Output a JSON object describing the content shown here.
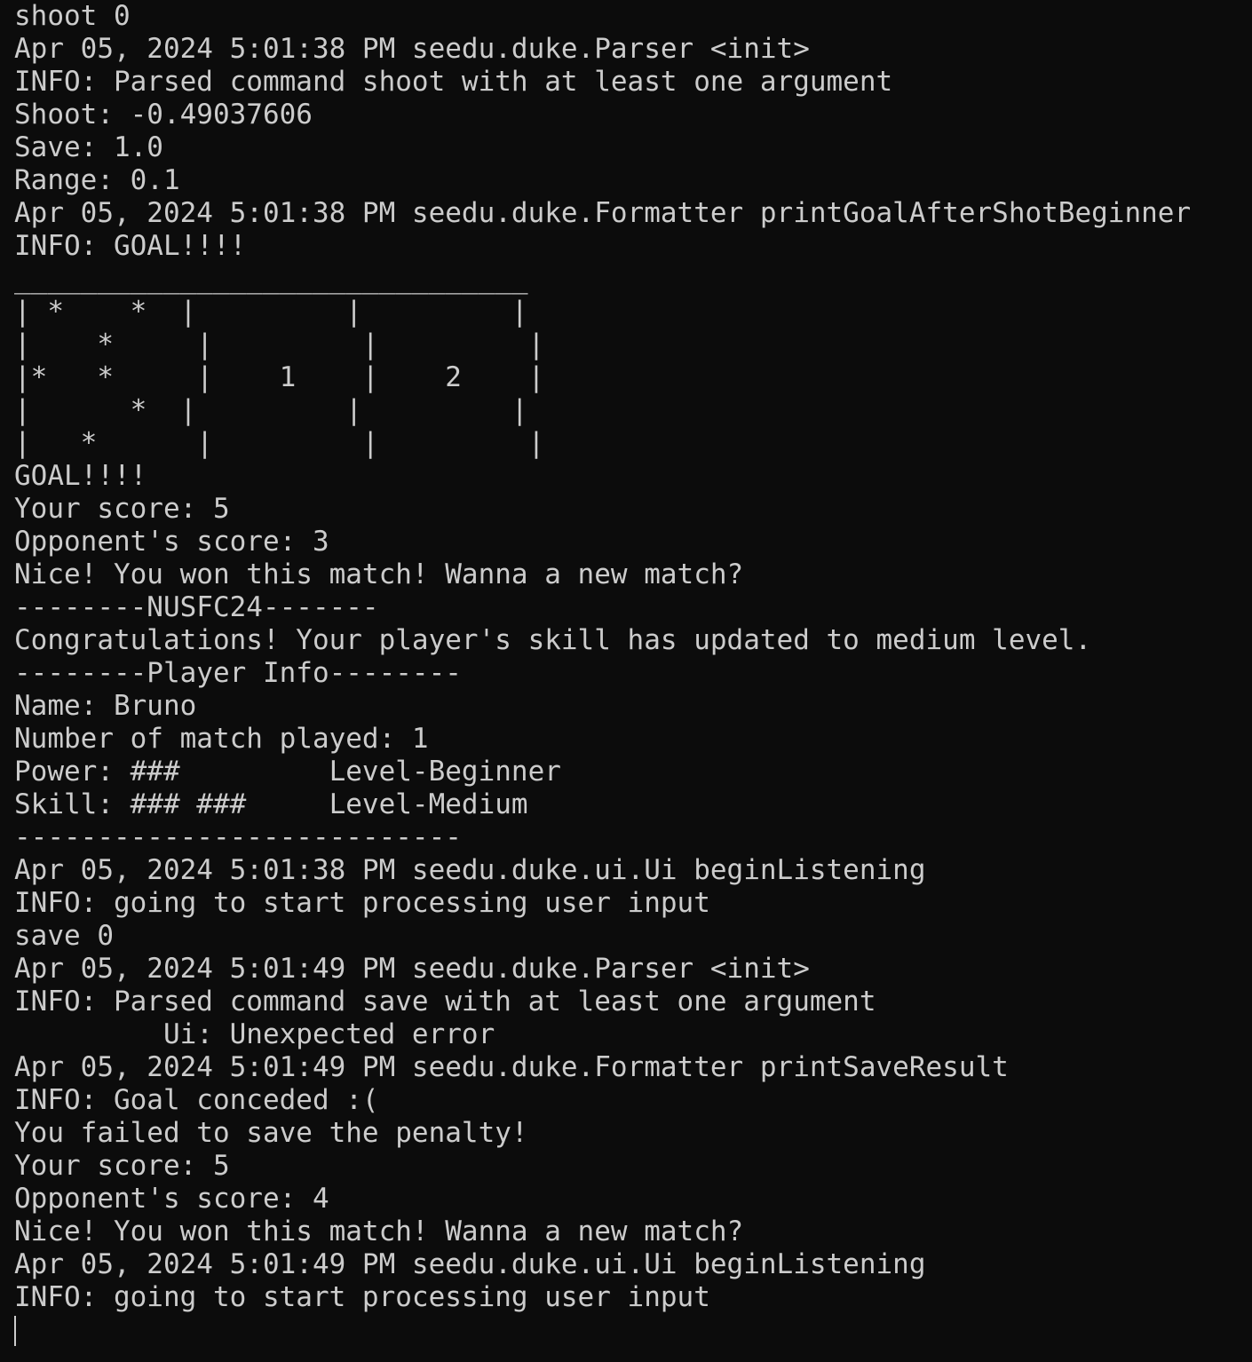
{
  "terminal": {
    "lines": [
      "shoot 0",
      "Apr 05, 2024 5:01:38 PM seedu.duke.Parser <init>",
      "INFO: Parsed command shoot with at least one argument",
      "Shoot: -0.49037606",
      "Save: 1.0",
      "Range: 0.1",
      "Apr 05, 2024 5:01:38 PM seedu.duke.Formatter printGoalAfterShotBeginner",
      "INFO: GOAL!!!!",
      "_______________________________",
      "| *    *  |         |         |",
      "|    *     |         |         |",
      "|*   *     |    1    |    2    |",
      "|      *  |         |         |",
      "|   *      |         |         |",
      "GOAL!!!!",
      "Your score: 5",
      "Opponent's score: 3",
      "Nice! You won this match! Wanna a new match?",
      "--------NUSFC24-------",
      "Congratulations! Your player's skill has updated to medium level.",
      "--------Player Info--------",
      "Name: Bruno",
      "Number of match played: 1",
      "Power: ###         Level-Beginner",
      "Skill: ### ###     Level-Medium",
      "---------------------------",
      "Apr 05, 2024 5:01:38 PM seedu.duke.ui.Ui beginListening",
      "INFO: going to start processing user input",
      "save 0",
      "Apr 05, 2024 5:01:49 PM seedu.duke.Parser <init>",
      "INFO: Parsed command save with at least one argument",
      "         Ui: Unexpected error",
      "Apr 05, 2024 5:01:49 PM seedu.duke.Formatter printSaveResult",
      "INFO: Goal conceded :(",
      "You failed to save the penalty!",
      "Your score: 5",
      "Opponent's score: 4",
      "Nice! You won this match! Wanna a new match?",
      "Apr 05, 2024 5:01:49 PM seedu.duke.ui.Ui beginListening",
      "INFO: going to start processing user input"
    ]
  },
  "colors": {
    "background": "#0c0c0c",
    "foreground": "#cccccc"
  }
}
